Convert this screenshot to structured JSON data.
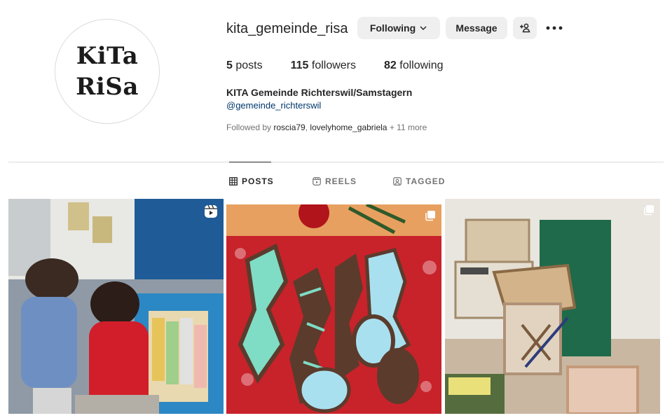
{
  "profile": {
    "username": "kita_gemeinde_risa",
    "logo_line1": "KiTa",
    "logo_line2": "RiSa",
    "full_name": "KITA Gemeinde Richterswil/Samstagern",
    "linked_handle": "@gemeinde_richterswil",
    "followed_by_prefix": "Followed by",
    "followed_by_user1": "roscia79",
    "followed_by_user2": "lovelyhome_gabriela",
    "followed_by_more": "+ 11 more"
  },
  "actions": {
    "following_label": "Following",
    "message_label": "Message",
    "add_user_icon": "add-user-icon",
    "more_icon": "more-options-icon"
  },
  "stats": {
    "posts_count": "5",
    "posts_label": "posts",
    "followers_count": "115",
    "followers_label": "followers",
    "following_count": "82",
    "following_label": "following"
  },
  "tabs": [
    {
      "label": "POSTS",
      "icon": "grid-icon",
      "active": true
    },
    {
      "label": "REELS",
      "icon": "reels-icon",
      "active": false
    },
    {
      "label": "TAGGED",
      "icon": "tagged-icon",
      "active": false
    }
  ],
  "posts": [
    {
      "type": "reel",
      "badge_icon": "reel-icon"
    },
    {
      "type": "carousel",
      "badge_icon": "carousel-icon"
    },
    {
      "type": "carousel",
      "badge_icon": "carousel-icon"
    }
  ]
}
